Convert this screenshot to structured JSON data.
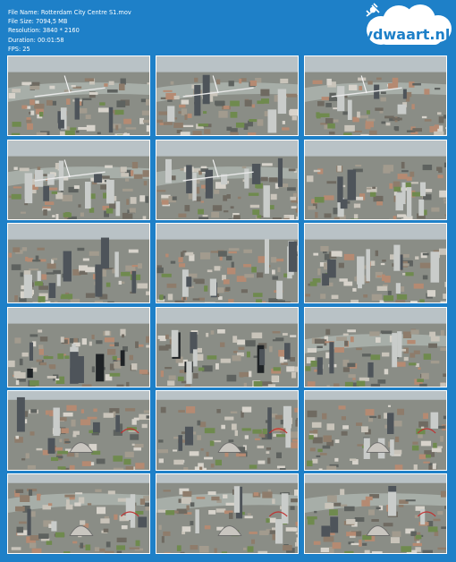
{
  "file_info": {
    "name_line": "File Name: Rotterdam City Centre S1.mov",
    "size_line": "File Size: 7094,5 MB",
    "resolution_line": "Resolution: 3840 * 2160",
    "duration_line": "Duration: 00:01:58",
    "fps_line": "FPS: 25"
  },
  "logo": {
    "text": "vdwaart.nl",
    "icon": "drone-icon",
    "cloud_color": "#ffffff",
    "text_color": "#1e80c8"
  },
  "colors": {
    "background": "#1e80c8",
    "thumb_border": "#ffffff"
  },
  "thumbnails": [
    {
      "scene": "skyline-bridge-river",
      "label": "frame-1"
    },
    {
      "scene": "skyline-bridge-river",
      "label": "frame-2"
    },
    {
      "scene": "skyline-bridge-river",
      "label": "frame-3"
    },
    {
      "scene": "bridge-river-towers",
      "label": "frame-4"
    },
    {
      "scene": "bridge-river-towers",
      "label": "frame-5"
    },
    {
      "scene": "dense-city-towers",
      "label": "frame-6"
    },
    {
      "scene": "dense-city-towers",
      "label": "frame-7"
    },
    {
      "scene": "dense-city-towers",
      "label": "frame-8"
    },
    {
      "scene": "dense-city-towers",
      "label": "frame-9"
    },
    {
      "scene": "black-towers-city",
      "label": "frame-10"
    },
    {
      "scene": "black-towers-city",
      "label": "frame-11"
    },
    {
      "scene": "city-river-horizon",
      "label": "frame-12"
    },
    {
      "scene": "markthal-city",
      "label": "frame-13"
    },
    {
      "scene": "markthal-city",
      "label": "frame-14"
    },
    {
      "scene": "markthal-city",
      "label": "frame-15"
    },
    {
      "scene": "markthal-river",
      "label": "frame-16"
    },
    {
      "scene": "markthal-river",
      "label": "frame-17"
    },
    {
      "scene": "markthal-river",
      "label": "frame-18"
    }
  ]
}
